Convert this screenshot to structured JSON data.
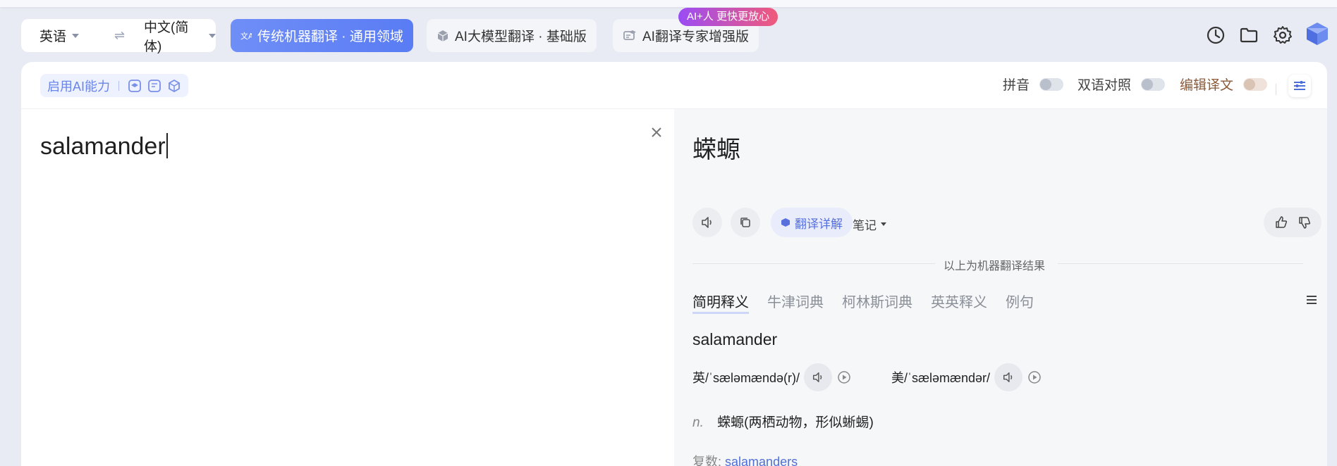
{
  "lang": {
    "source": "英语",
    "target": "中文(简体)",
    "swap_glyph": "⇌"
  },
  "modes": [
    {
      "label": "传统机器翻译 · 通用领域",
      "active": true
    },
    {
      "label": "AI大模型翻译 · 基础版",
      "active": false
    },
    {
      "label": "AI翻译专家增强版",
      "active": false
    }
  ],
  "promo_badge": "AI+人 更快更放心",
  "toolbar": {
    "ai_label": "启用AI能力",
    "pinyin_label": "拼音",
    "bilingual_label": "双语对照",
    "edit_label": "编辑译文"
  },
  "source": {
    "text": "salamander"
  },
  "result": {
    "text": "蝾螈",
    "detail_label": "翻译详解",
    "notes_label": "笔记",
    "machine_note": "以上为机器翻译结果"
  },
  "dict": {
    "tabs": [
      "简明释义",
      "牛津词典",
      "柯林斯词典",
      "英英释义",
      "例句"
    ],
    "active_tab": 0,
    "word": "salamander",
    "uk_phonetic": "英/ˈsæləmændə(r)/",
    "us_phonetic": "美/ˈsæləmændər/",
    "pos": "n.",
    "definition": "蝾螈(两栖动物，形似蜥蜴)",
    "plural_label": "复数:",
    "plural_word": "salamanders"
  },
  "colors": {
    "accent": "#5a7cf4",
    "background": "#e8ebf3",
    "promo_start": "#9b4cf5",
    "promo_end": "#f05a7a"
  },
  "icons": [
    "history-icon",
    "folder-icon",
    "settings-icon",
    "cube-logo-icon"
  ]
}
